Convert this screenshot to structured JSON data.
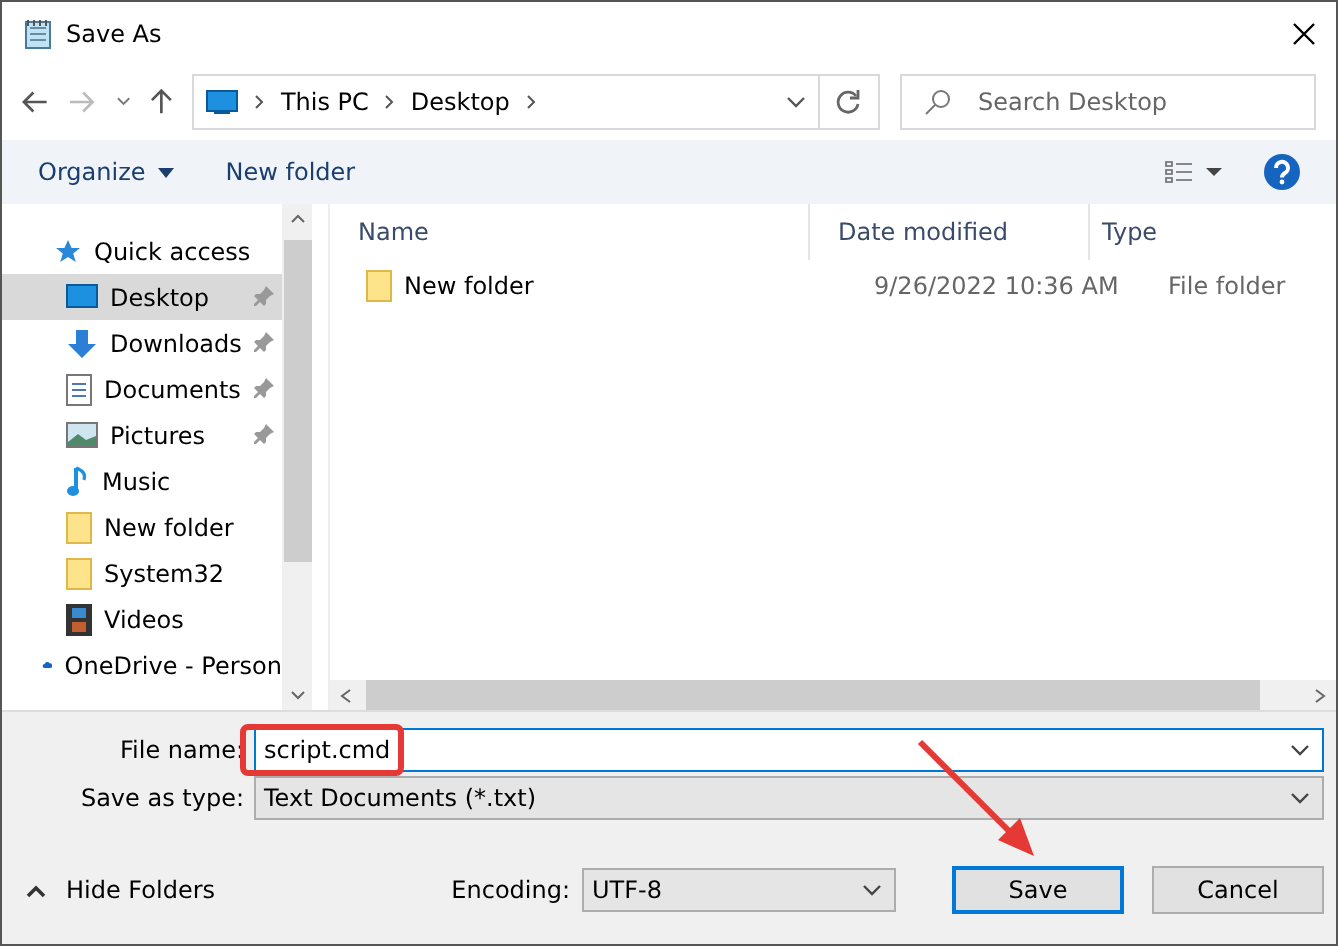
{
  "window": {
    "title": "Save As"
  },
  "address": {
    "crumbs": [
      "This PC",
      "Desktop"
    ]
  },
  "search": {
    "placeholder": "Search Desktop"
  },
  "toolbar": {
    "organize": "Organize",
    "new_folder": "New folder"
  },
  "sidebar": {
    "items": [
      {
        "label": "Quick access",
        "kind": "star",
        "selected": false,
        "pinned": false
      },
      {
        "label": "Desktop",
        "kind": "desktop",
        "selected": true,
        "pinned": true
      },
      {
        "label": "Downloads",
        "kind": "download",
        "selected": false,
        "pinned": true
      },
      {
        "label": "Documents",
        "kind": "document",
        "selected": false,
        "pinned": true
      },
      {
        "label": "Pictures",
        "kind": "picture",
        "selected": false,
        "pinned": true
      },
      {
        "label": "Music",
        "kind": "music",
        "selected": false,
        "pinned": false
      },
      {
        "label": "New folder",
        "kind": "folder",
        "selected": false,
        "pinned": false
      },
      {
        "label": "System32",
        "kind": "folder",
        "selected": false,
        "pinned": false
      },
      {
        "label": "Videos",
        "kind": "video",
        "selected": false,
        "pinned": false
      },
      {
        "label": "OneDrive - Person",
        "kind": "cloud",
        "selected": false,
        "pinned": false
      }
    ]
  },
  "table": {
    "columns": [
      "Name",
      "Date modified",
      "Type"
    ],
    "rows": [
      {
        "name": "New folder",
        "date": "9/26/2022 10:36 AM",
        "type": "File folder"
      }
    ]
  },
  "form": {
    "file_name_label": "File name:",
    "file_name": "script.cmd",
    "type_label": "Save as type:",
    "type": "Text Documents (*.txt)",
    "encoding_label": "Encoding:",
    "encoding": "UTF-8"
  },
  "hide_folders": "Hide Folders",
  "buttons": [
    "Save",
    "Cancel"
  ]
}
